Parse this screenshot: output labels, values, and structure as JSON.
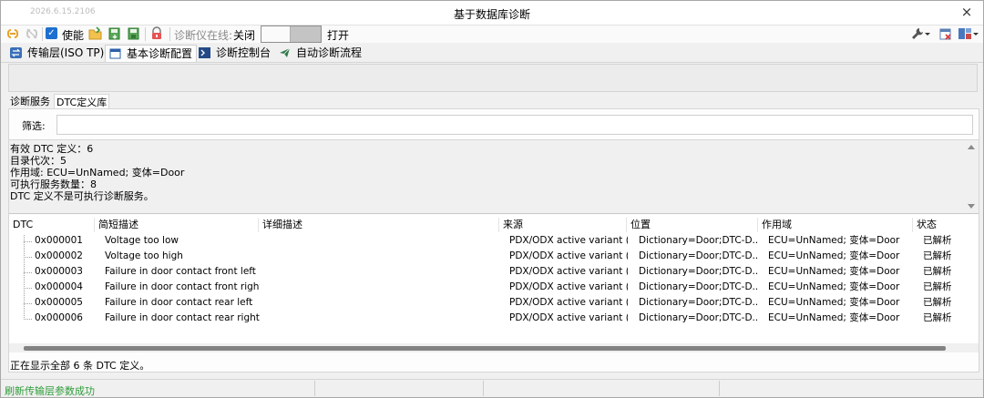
{
  "window": {
    "version": "2026.6.15.2106",
    "title": "基于数据库诊断",
    "close_glyph": "×"
  },
  "toolbar": {
    "enable_label": "使能",
    "tester_online_label": "诊断仪在线:",
    "off_label": "关闭",
    "on_label": "打开",
    "tester_online_toggle": "off",
    "enable_checked": true
  },
  "main_tabs": [
    {
      "label": "传输层(ISO TP)",
      "icon": "transport-icon",
      "active": false
    },
    {
      "label": "基本诊断配置",
      "icon": "window-icon",
      "active": true
    },
    {
      "label": "诊断控制台",
      "icon": "console-icon",
      "active": false
    },
    {
      "label": "自动诊断流程",
      "icon": "send-icon",
      "active": false
    }
  ],
  "sub_tabs": [
    {
      "label": "诊断服务",
      "active": false
    },
    {
      "label": "DTC定义库",
      "active": true
    }
  ],
  "filter": {
    "label": "筛选:",
    "value": ""
  },
  "info": {
    "lines": [
      "有效 DTC 定义：6",
      "目录代次：5",
      "作用域: ECU=UnNamed; 变体=Door",
      "可执行服务数量：8",
      "DTC 定义不是可执行诊断服务。"
    ]
  },
  "table": {
    "columns": [
      "DTC",
      "简短描述",
      "详细描述",
      "来源",
      "位置",
      "作用域",
      "状态"
    ],
    "rows": [
      {
        "dtc": "0x000001",
        "short": "Voltage too low",
        "detail": "",
        "source": "PDX/ODX active variant (...",
        "location": "Dictionary=Door;DTC-D...",
        "scope": "ECU=UnNamed; 变体=Door",
        "status": "已解析"
      },
      {
        "dtc": "0x000002",
        "short": "Voltage too high",
        "detail": "",
        "source": "PDX/ODX active variant (...",
        "location": "Dictionary=Door;DTC-D...",
        "scope": "ECU=UnNamed; 变体=Door",
        "status": "已解析"
      },
      {
        "dtc": "0x000003",
        "short": "Failure in door contact front left",
        "detail": "",
        "source": "PDX/ODX active variant (...",
        "location": "Dictionary=Door;DTC-D...",
        "scope": "ECU=UnNamed; 变体=Door",
        "status": "已解析"
      },
      {
        "dtc": "0x000004",
        "short": "Failure in door contact front right",
        "detail": "",
        "source": "PDX/ODX active variant (...",
        "location": "Dictionary=Door;DTC-D...",
        "scope": "ECU=UnNamed; 变体=Door",
        "status": "已解析"
      },
      {
        "dtc": "0x000005",
        "short": "Failure in door contact rear left",
        "detail": "",
        "source": "PDX/ODX active variant (...",
        "location": "Dictionary=Door;DTC-D...",
        "scope": "ECU=UnNamed; 变体=Door",
        "status": "已解析"
      },
      {
        "dtc": "0x000006",
        "short": "Failure in door contact rear right",
        "detail": "",
        "source": "PDX/ODX active variant (...",
        "location": "Dictionary=Door;DTC-D...",
        "scope": "ECU=UnNamed; 变体=Door",
        "status": "已解析"
      }
    ]
  },
  "status_line": "正在显示全部 6 条 DTC 定义。",
  "statusbar": {
    "message": "刷新传输层参数成功"
  },
  "colors": {
    "success_text": "#2e9d3a",
    "checkbox": "#1e6fd0"
  }
}
